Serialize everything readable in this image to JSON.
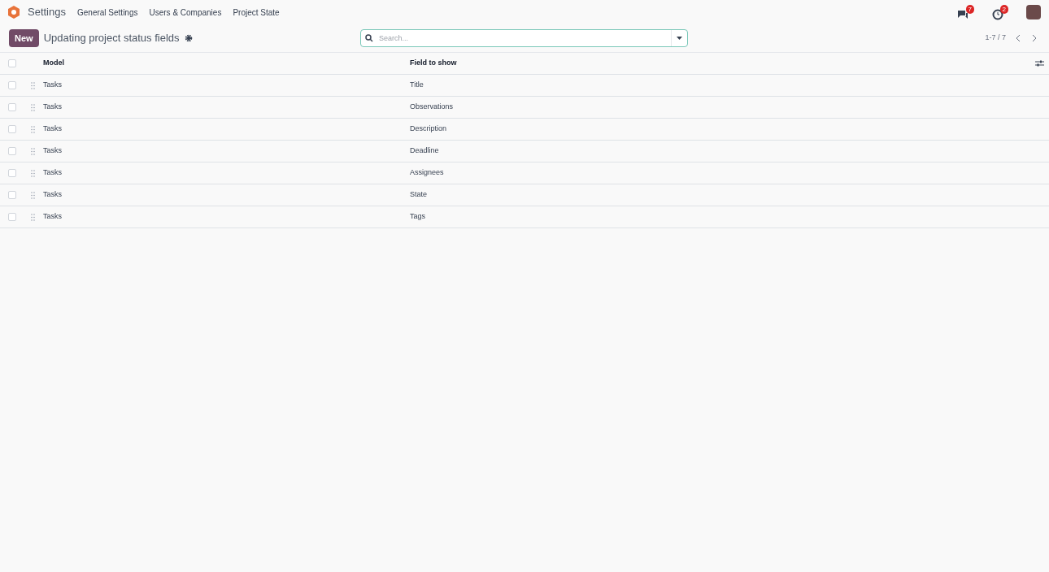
{
  "navbar": {
    "app": "Settings",
    "menu": [
      "General Settings",
      "Users & Companies",
      "Project State"
    ],
    "messages_badge": "7",
    "activities_badge": "2"
  },
  "control_panel": {
    "new_button": "New",
    "title": "Updating project status fields",
    "search": {
      "placeholder": "Search..."
    },
    "pager": "1-7 / 7"
  },
  "table": {
    "columns": [
      "Model",
      "Field to show"
    ],
    "all_checked": false,
    "rows": [
      {
        "model": "Tasks",
        "field": "Title",
        "checked": false
      },
      {
        "model": "Tasks",
        "field": "Observations",
        "checked": false
      },
      {
        "model": "Tasks",
        "field": "Description",
        "checked": false
      },
      {
        "model": "Tasks",
        "field": "Deadline",
        "checked": false
      },
      {
        "model": "Tasks",
        "field": "Assignees",
        "checked": false
      },
      {
        "model": "Tasks",
        "field": "State",
        "checked": false
      },
      {
        "model": "Tasks",
        "field": "Tags",
        "checked": false
      }
    ]
  }
}
